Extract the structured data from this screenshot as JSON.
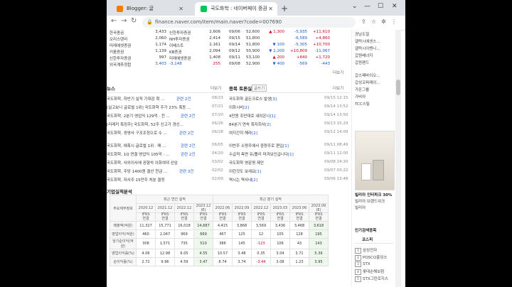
{
  "browser": {
    "tabs": [
      {
        "label": "Blogger: 글",
        "favicon_color": "#f57c00"
      },
      {
        "label": "국도화학 : 네이버페이 증권",
        "favicon_color": "#03c75a"
      }
    ],
    "url": "finance.naver.com/item/main.naver?code=007690"
  },
  "peer_table": {
    "rows": [
      {
        "c1": "한국종금",
        "c2": "3,433",
        "c3": "신한투자증권",
        "c4": "2,606"
      },
      {
        "c1": "오리스탠리",
        "c2": "2,060",
        "c3": "NH투자증권",
        "c4": "2,414"
      },
      {
        "c1": "미래에셋증권",
        "c2": "1,174",
        "c3": "이베스트",
        "c4": "2,161"
      },
      {
        "c1": "키움증권",
        "c2": "1,139",
        "c3": "KB증권",
        "c4": "2,094"
      },
      {
        "c1": "신한투자증권",
        "c2": "997",
        "c3": "미래에셋증권",
        "c4": "1,408"
      },
      {
        "c1": "외국계추정합",
        "c2": "3,403",
        "c3": "-3,148",
        "c4": "255"
      }
    ]
  },
  "daily": {
    "rows": [
      {
        "date": "09/06",
        "price": "52,600",
        "chg": "1,300",
        "dir": "up",
        "v1": "-5,935",
        "v2": "+11,610"
      },
      {
        "date": "09/15",
        "price": "51,800",
        "chg": "",
        "dir": "",
        "v1": "-6,589",
        "v2": "+4,860"
      },
      {
        "date": "09/14",
        "price": "51,800",
        "chg": "100",
        "dir": "dn",
        "v1": "-5,305",
        "v2": "+10,700"
      },
      {
        "date": "09/12",
        "price": "50,900",
        "chg": "2,200",
        "dir": "dn",
        "v1": "+10,809",
        "v2": "-11,067"
      },
      {
        "date": "09/11",
        "price": "53,100",
        "chg": "200",
        "dir": "up",
        "v1": "+840",
        "v2": "+1,720"
      },
      {
        "date": "09/08",
        "price": "52,900",
        "chg": "400",
        "dir": "dn",
        "v1": "-569",
        "v2": "-443"
      }
    ],
    "more": "더보기"
  },
  "news": {
    "title": "뉴스",
    "more": "더보기",
    "items": [
      {
        "title": "국도화학, 하반기 실적 기대감 확 ...",
        "related": "관련 2건",
        "date": "08/23"
      },
      {
        "title": "[실고보니 글로벌 1위] 국도화학 주가 23% 폭등 ...",
        "related": "",
        "date": "07/21"
      },
      {
        "title": "국도화학, 2분기 영업익 129억 · 전 ...",
        "related": "관련 2건",
        "date": "07/20"
      },
      {
        "title": "[리레커 특징주] 국도화학, 52주 신고가 경신...",
        "related": "",
        "date": "06/26"
      },
      {
        "title": "국도화학, 경영사 구조조정으로 수 ...",
        "related": "관련 2건",
        "date": "06/28"
      },
      {
        "title": "국도화학, 에폭시 글로벌 1위 · 매 ...",
        "related": "관련 2건",
        "date": "06/05"
      },
      {
        "title": "국도화학, 1Q 연결 영업익 105억 · ...",
        "related": "관련 2건",
        "date": "04/20"
      },
      {
        "title": "국도화학, 사외이사에 권형석 이화여대 선임",
        "related": "",
        "date": "03/02"
      },
      {
        "title": "국도화학, 주당 1400원 결산 현금 ...",
        "related": "관련 3건",
        "date": "02/02"
      },
      {
        "title": "국도화학, 자사주 15만주 처분 결정",
        "related": "",
        "date": "02/09"
      }
    ]
  },
  "board": {
    "title": "종목 토론실",
    "write": "글쓰기",
    "more": "더보기",
    "items": [
      {
        "title": "국도화학 골든크로스 발생",
        "count": "[3]",
        "date": "09/15 12:15"
      },
      {
        "title": "이화시비",
        "count": "[2]",
        "date": "09/14 13:52"
      },
      {
        "title": "4만원 조만대로 내려온니",
        "count": "[1]",
        "date": "09/14 13:50"
      },
      {
        "title": "84분기 연속 흑자회사",
        "count": "[2]",
        "date": "09/13 15:29"
      },
      {
        "title": "여지간히 해라",
        "count": "[2]",
        "date": "09/12 14:09"
      },
      {
        "title": "이번주 소량주에서 중량주로 편입",
        "count": "[1]",
        "date": "09/11 08:49"
      },
      {
        "title": "수급적 측면 유/틀리 마겨보인급니다",
        "count": "[1]",
        "date": "09/11 12:00"
      },
      {
        "title": "국도화학 영문명 제안",
        "count": "",
        "date": "09/08 24:20"
      },
      {
        "title": "이런것도 보세요",
        "count": "[1]",
        "date": "09/07 03:22"
      },
      {
        "title": "역시는 역사네",
        "count": "[2]",
        "date": "09/06 13:48"
      }
    ]
  },
  "financials": {
    "title": "기업실적분석",
    "label_col": "주요재무정보",
    "annual_header": "최근 연간 실적",
    "quarter_header": "최근 분기 실적",
    "annual_years": [
      "2020.12",
      "2021.12",
      "2022.12",
      "2023.12"
    ],
    "quarter_years": [
      "2022.06",
      "2022.09",
      "2022.12",
      "2023.03",
      "2023.06",
      "2023.09"
    ],
    "estimate_mark": "(E)",
    "ifrs_label": "IFRS",
    "ifrs_sub": "연결",
    "rows": [
      {
        "label": "매출액(억원)",
        "annual": [
          "11,327",
          "15,771",
          "16,018",
          "14,687"
        ],
        "quarter": [
          "4,415",
          "3,868",
          "3,569",
          "3,436",
          "3,468",
          "3,618"
        ]
      },
      {
        "label": "영업이익(억원)",
        "annual": [
          "460",
          "2,047",
          "969",
          "669"
        ],
        "quarter": [
          "467",
          "125",
          "12",
          "105",
          "128",
          "195"
        ]
      },
      {
        "label": "당기순이익(억원)",
        "annual": [
          "308",
          "1,571",
          "735",
          "510"
        ],
        "quarter": [
          "386",
          "145",
          "-123",
          "106",
          "43",
          "143"
        ]
      },
      {
        "label": "영업이익률(%)",
        "annual": [
          "4.06",
          "12.98",
          "6.05",
          "4.55"
        ],
        "quarter": [
          "10.57",
          "3.48",
          "0.35",
          "3.04",
          "3.71",
          "5.39"
        ]
      },
      {
        "label": "순이익률(%)",
        "annual": [
          "2.72",
          "9.96",
          "4.59",
          "3.47"
        ],
        "quarter": [
          "8.74",
          "3.74",
          "-3.44",
          "3.08",
          "1.23",
          "3.95"
        ]
      }
    ]
  },
  "sidebar": {
    "top_items": [
      "경남도절",
      "갤럭시에센스...",
      "갤럭시이벤니...",
      "갑원베녀지",
      "갑원팬드"
    ],
    "mid_items": [
      "갑스페바이오...",
      "갑성코퍼레이...",
      "가온그룹",
      "가비아",
      "TCC스틸"
    ],
    "ad_title": "빌리아 인터파크 30%",
    "ad_line2": "빌리아 브랜드위크",
    "ad_line3": "빌리아",
    "popular_title": "인기검색종목",
    "popular_tab": "코스피",
    "popular_items": [
      {
        "rank": "1",
        "name": "삼성전자"
      },
      {
        "rank": "2",
        "name": "POSCO홀딩스"
      },
      {
        "rank": "3",
        "name": "STX"
      },
      {
        "rank": "4",
        "name": "롯데손해보험"
      },
      {
        "rank": "5",
        "name": "STX그린로지스"
      }
    ]
  }
}
